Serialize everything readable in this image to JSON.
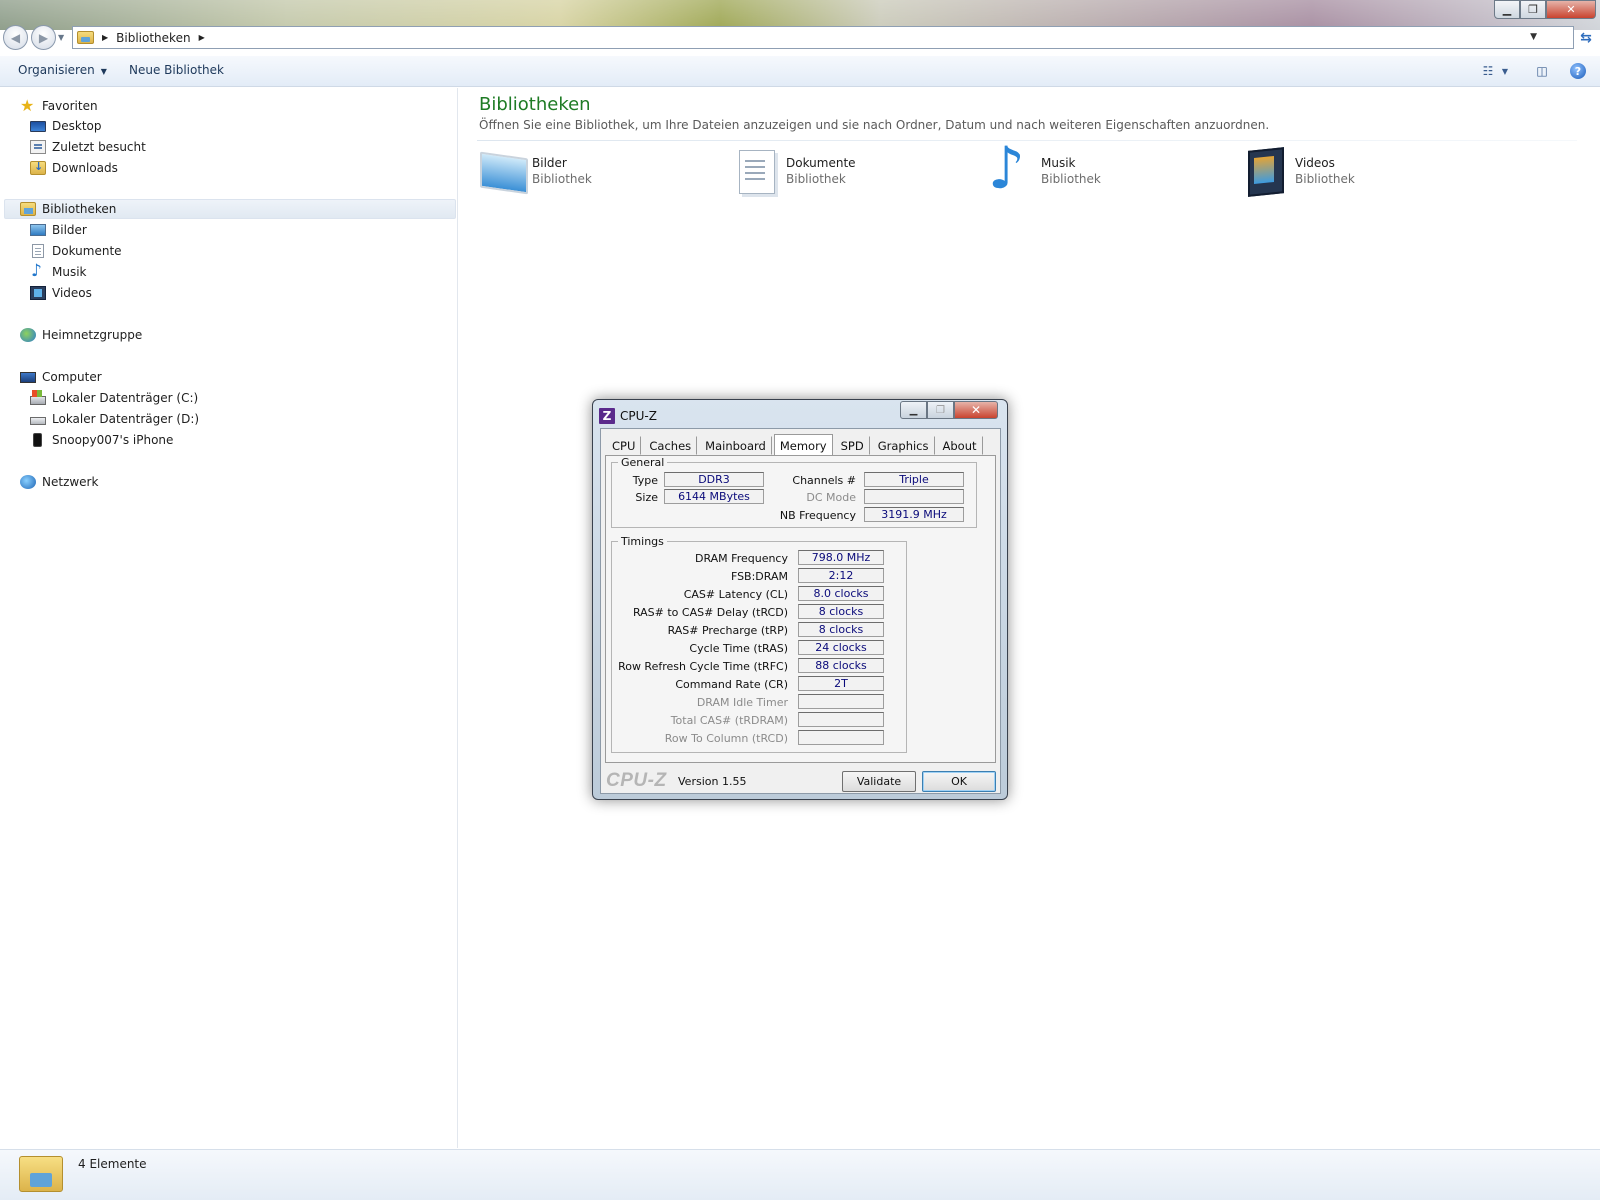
{
  "explorer": {
    "breadcrumb": [
      "Bibliotheken"
    ],
    "commands": {
      "organize": "Organisieren",
      "new_library": "Neue Bibliothek"
    },
    "sidebar": {
      "favorites": {
        "label": "Favoriten",
        "items": [
          "Desktop",
          "Zuletzt besucht",
          "Downloads"
        ]
      },
      "libraries": {
        "label": "Bibliotheken",
        "items": [
          "Bilder",
          "Dokumente",
          "Musik",
          "Videos"
        ]
      },
      "homegroup": "Heimnetzgruppe",
      "computer": {
        "label": "Computer",
        "items": [
          "Lokaler Datenträger (C:)",
          "Lokaler Datenträger (D:)",
          "Snoopy007's iPhone"
        ]
      },
      "network": "Netzwerk"
    },
    "main": {
      "title": "Bibliotheken",
      "description": "Öffnen Sie eine Bibliothek, um Ihre Dateien anzuzeigen und sie nach Ordner, Datum und nach weiteren Eigenschaften anzuordnen.",
      "libraries": [
        {
          "name": "Bilder",
          "type": "Bibliothek",
          "icon": "pictures-library-icon"
        },
        {
          "name": "Dokumente",
          "type": "Bibliothek",
          "icon": "documents-library-icon"
        },
        {
          "name": "Musik",
          "type": "Bibliothek",
          "icon": "music-library-icon"
        },
        {
          "name": "Videos",
          "type": "Bibliothek",
          "icon": "videos-library-icon"
        }
      ]
    },
    "status": {
      "count": "4 Elemente"
    },
    "colors": {
      "title_green": "#1e7b24",
      "command_text": "#1e395b",
      "value_text": "#0a0a7a"
    }
  },
  "cpuz": {
    "title": "CPU-Z",
    "tabs": [
      "CPU",
      "Caches",
      "Mainboard",
      "Memory",
      "SPD",
      "Graphics",
      "About"
    ],
    "active_tab": "Memory",
    "general": {
      "legend": "General",
      "type_label": "Type",
      "type_value": "DDR3",
      "size_label": "Size",
      "size_value": "6144 MBytes",
      "channels_label": "Channels #",
      "channels_value": "Triple",
      "dcmode_label": "DC Mode",
      "dcmode_value": "",
      "nbfreq_label": "NB Frequency",
      "nbfreq_value": "3191.9 MHz"
    },
    "timings": {
      "legend": "Timings",
      "rows": [
        {
          "label": "DRAM Frequency",
          "value": "798.0 MHz"
        },
        {
          "label": "FSB:DRAM",
          "value": "2:12"
        },
        {
          "label": "CAS# Latency (CL)",
          "value": "8.0 clocks"
        },
        {
          "label": "RAS# to CAS# Delay (tRCD)",
          "value": "8 clocks"
        },
        {
          "label": "RAS# Precharge (tRP)",
          "value": "8 clocks"
        },
        {
          "label": "Cycle Time (tRAS)",
          "value": "24 clocks"
        },
        {
          "label": "Row Refresh Cycle Time (tRFC)",
          "value": "88 clocks"
        },
        {
          "label": "Command Rate (CR)",
          "value": "2T"
        },
        {
          "label": "DRAM Idle Timer",
          "value": ""
        },
        {
          "label": "Total CAS# (tRDRAM)",
          "value": ""
        },
        {
          "label": "Row To Column (tRCD)",
          "value": ""
        }
      ]
    },
    "footer": {
      "brand": "CPU-Z",
      "version": "Version 1.55",
      "validate": "Validate",
      "ok": "OK"
    }
  }
}
